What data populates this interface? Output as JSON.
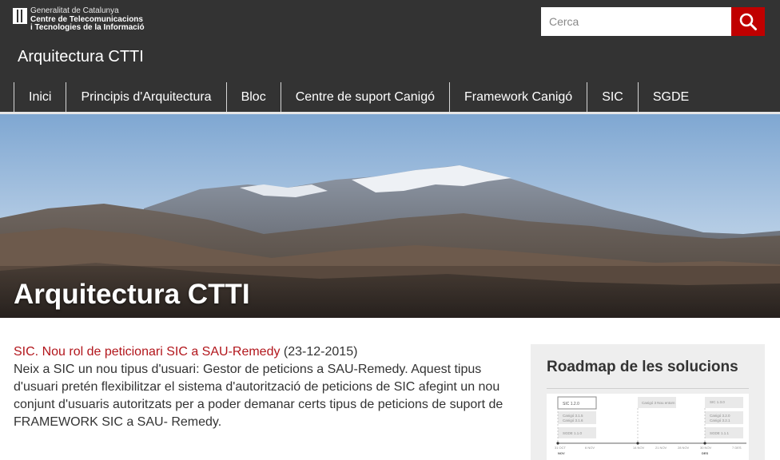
{
  "org": {
    "line1": "Generalitat de Catalunya",
    "line2": "Centre de Telecomunicacions",
    "line3": "i Tecnologies de la Informació"
  },
  "site_title": "Arquitectura CTTI",
  "search": {
    "placeholder": "Cerca",
    "icon": "search-icon"
  },
  "nav": {
    "items": [
      {
        "label": "Inici"
      },
      {
        "label": "Principis d'Arquitectura"
      },
      {
        "label": "Bloc"
      },
      {
        "label": "Centre de suport Canigó"
      },
      {
        "label": "Framework Canigó"
      },
      {
        "label": "SIC"
      },
      {
        "label": "SGDE"
      }
    ]
  },
  "hero": {
    "title": "Arquitectura CTTI"
  },
  "news": {
    "link_text": "SIC. Nou rol de peticionari SIC a SAU-Remedy",
    "date": "(23-12-2015)",
    "body": "Neix a SIC un nou tipus d'usuari: Gestor de peticions a SAU-Remedy. Aquest tipus d'usuari pretén flexibilitzar el sistema d'autorització de peticions de SIC afegint un nou conjunt d'usuaris autoritzats per a poder demanar certs tipus de peticions de suport de FRAMEWORK SIC a SAU- Remedy."
  },
  "aside": {
    "title": "Roadmap de les solucions",
    "roadmap": {
      "boxes": [
        "SIC 1.2.0",
        "Canigó 3.1.5",
        "Canigó 3.1.6",
        "SGDE 1.1.0",
        "Canigó 3 Nou entorn",
        "SIC 1.3.0",
        "Canigó 3.2.0",
        "Canigó 3.2.1",
        "SGDE 1.1.1"
      ],
      "dates": [
        "31 OCT",
        "6 NOV",
        "14 NOV",
        "21 NOV",
        "28 NOV",
        "30 NOV",
        "7 DES"
      ],
      "months": [
        "NOV",
        "DES"
      ]
    }
  },
  "colors": {
    "header_bg": "#333333",
    "accent": "#c00000",
    "link": "#b2161c",
    "aside_bg": "#eeeeee"
  }
}
